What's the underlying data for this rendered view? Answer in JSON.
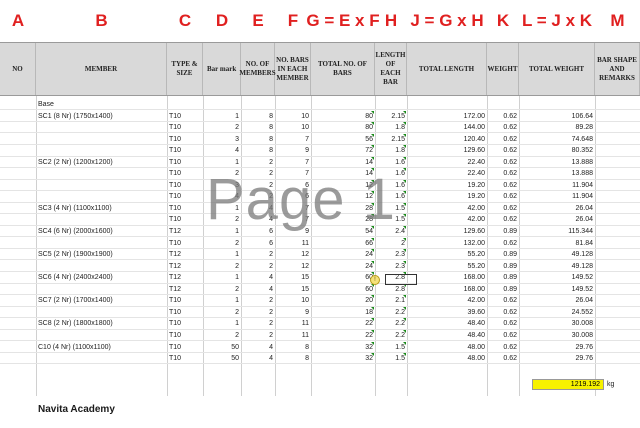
{
  "column_letters": [
    "A",
    "B",
    "C",
    "D",
    "E",
    "F",
    "G = E x F",
    "H",
    "J = G x H",
    "K",
    "L = J x K",
    "M"
  ],
  "headers": [
    "NO",
    "MEMBER",
    "TYPE & SIZE",
    "Bar mark",
    "NO. OF MEMBERS",
    "NO. BARS IN EACH MEMBER",
    "TOTAL NO. OF BARS",
    "LENGTH OF EACH BAR",
    "TOTAL LENGTH",
    "WEIGHT",
    "TOTAL WEIGHT",
    "BAR SHAPE AND REMARKS"
  ],
  "section_label": "Base",
  "rows": [
    {
      "member": "SC1 (8 Nr) (1750x1400)",
      "type": "T10",
      "mark": "1",
      "nmem": "8",
      "nbars": "10",
      "total": "80",
      "len": "2.15",
      "tlen": "172.00",
      "wt": "0.62",
      "twt": "106.64"
    },
    {
      "member": "",
      "type": "T10",
      "mark": "2",
      "nmem": "8",
      "nbars": "10",
      "total": "80",
      "len": "1.8",
      "tlen": "144.00",
      "wt": "0.62",
      "twt": "89.28"
    },
    {
      "member": "",
      "type": "T10",
      "mark": "3",
      "nmem": "8",
      "nbars": "7",
      "total": "56",
      "len": "2.15",
      "tlen": "120.40",
      "wt": "0.62",
      "twt": "74.648"
    },
    {
      "member": "",
      "type": "T10",
      "mark": "4",
      "nmem": "8",
      "nbars": "9",
      "total": "72",
      "len": "1.8",
      "tlen": "129.60",
      "wt": "0.62",
      "twt": "80.352"
    },
    {
      "member": "SC2 (2 Nr) (1200x1200)",
      "type": "T10",
      "mark": "1",
      "nmem": "2",
      "nbars": "7",
      "total": "14",
      "len": "1.6",
      "tlen": "22.40",
      "wt": "0.62",
      "twt": "13.888"
    },
    {
      "member": "",
      "type": "T10",
      "mark": "2",
      "nmem": "2",
      "nbars": "7",
      "total": "14",
      "len": "1.6",
      "tlen": "22.40",
      "wt": "0.62",
      "twt": "13.888"
    },
    {
      "member": "",
      "type": "T10",
      "mark": "3",
      "nmem": "2",
      "nbars": "6",
      "total": "12",
      "len": "1.6",
      "tlen": "19.20",
      "wt": "0.62",
      "twt": "11.904"
    },
    {
      "member": "",
      "type": "T10",
      "mark": "4",
      "nmem": "2",
      "nbars": "6",
      "total": "12",
      "len": "1.6",
      "tlen": "19.20",
      "wt": "0.62",
      "twt": "11.904"
    },
    {
      "member": "SC3 (4 Nr) (1100x1100)",
      "type": "T10",
      "mark": "1",
      "nmem": "4",
      "nbars": "7",
      "total": "28",
      "len": "1.5",
      "tlen": "42.00",
      "wt": "0.62",
      "twt": "26.04"
    },
    {
      "member": "",
      "type": "T10",
      "mark": "2",
      "nmem": "4",
      "nbars": "7",
      "total": "28",
      "len": "1.5",
      "tlen": "42.00",
      "wt": "0.62",
      "twt": "26.04"
    },
    {
      "member": "SC4 (6 Nr) (2000x1600)",
      "type": "T12",
      "mark": "1",
      "nmem": "6",
      "nbars": "9",
      "total": "54",
      "len": "2.4",
      "tlen": "129.60",
      "wt": "0.89",
      "twt": "115.344"
    },
    {
      "member": "",
      "type": "T10",
      "mark": "2",
      "nmem": "6",
      "nbars": "11",
      "total": "66",
      "len": "2",
      "tlen": "132.00",
      "wt": "0.62",
      "twt": "81.84"
    },
    {
      "member": "SC5 (2 Nr) (1900x1900)",
      "type": "T12",
      "mark": "1",
      "nmem": "2",
      "nbars": "12",
      "total": "24",
      "len": "2.3",
      "tlen": "55.20",
      "wt": "0.89",
      "twt": "49.128"
    },
    {
      "member": "",
      "type": "T12",
      "mark": "2",
      "nmem": "2",
      "nbars": "12",
      "total": "24",
      "len": "2.3",
      "tlen": "55.20",
      "wt": "0.89",
      "twt": "49.128"
    },
    {
      "member": "SC6 (4 Nr) (2400x2400)",
      "type": "T12",
      "mark": "1",
      "nmem": "4",
      "nbars": "15",
      "total": "60",
      "len": "2.8",
      "tlen": "168.00",
      "wt": "0.89",
      "twt": "149.52"
    },
    {
      "member": "",
      "type": "T12",
      "mark": "2",
      "nmem": "4",
      "nbars": "15",
      "total": "60",
      "len": "2.8",
      "tlen": "168.00",
      "wt": "0.89",
      "twt": "149.52"
    },
    {
      "member": "SC7 (2 Nr) (1700x1400)",
      "type": "T10",
      "mark": "1",
      "nmem": "2",
      "nbars": "10",
      "total": "20",
      "len": "2.1",
      "tlen": "42.00",
      "wt": "0.62",
      "twt": "26.04"
    },
    {
      "member": "",
      "type": "T10",
      "mark": "2",
      "nmem": "2",
      "nbars": "9",
      "total": "18",
      "len": "2.2",
      "tlen": "39.60",
      "wt": "0.62",
      "twt": "24.552"
    },
    {
      "member": "SC8 (2 Nr) (1800x1800)",
      "type": "T10",
      "mark": "1",
      "nmem": "2",
      "nbars": "11",
      "total": "22",
      "len": "2.2",
      "tlen": "48.40",
      "wt": "0.62",
      "twt": "30.008"
    },
    {
      "member": "",
      "type": "T10",
      "mark": "2",
      "nmem": "2",
      "nbars": "11",
      "total": "22",
      "len": "2.2",
      "tlen": "48.40",
      "wt": "0.62",
      "twt": "30.008"
    },
    {
      "member": "C10 (4 Nr) (1100x1100)",
      "type": "T10",
      "mark": "50",
      "nmem": "4",
      "nbars": "8",
      "total": "32",
      "len": "1.5",
      "tlen": "48.00",
      "wt": "0.62",
      "twt": "29.76"
    },
    {
      "member": "",
      "type": "T10",
      "mark": "50",
      "nmem": "4",
      "nbars": "8",
      "total": "32",
      "len": "1.5",
      "tlen": "48.00",
      "wt": "0.62",
      "twt": "29.76"
    }
  ],
  "grand_total": "1219.192",
  "grand_total_unit": "kg",
  "watermark": "Page 1",
  "brand": "Navita Academy",
  "colors": {
    "letters": "#e02020",
    "header_bg": "#d9d9d9",
    "total_highlight": "#f7f200",
    "comment_marker": "#1a8a1a"
  }
}
